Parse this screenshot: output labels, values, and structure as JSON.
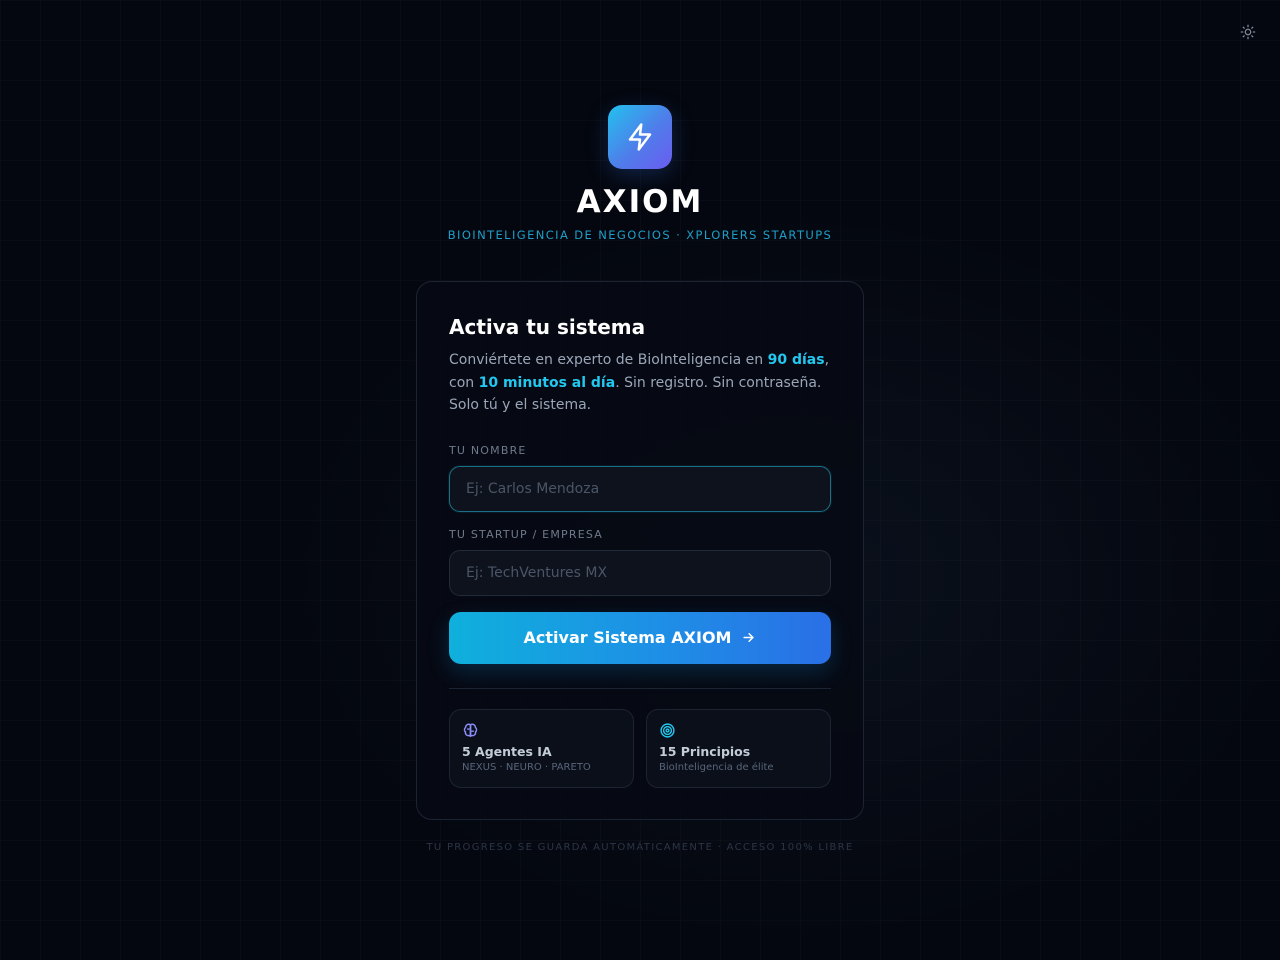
{
  "theme_toggle": {
    "icon": "sun-icon"
  },
  "brand": {
    "logo_icon": "lightning-icon",
    "title": "AXIOM",
    "subtitle": "BIOINTELIGENCIA DE NEGOCIOS · XPLORERS STARTUPS"
  },
  "card": {
    "title": "Activa tu sistema",
    "description": {
      "part1": "Conviértete en experto de BioInteligencia en ",
      "highlight1": "90 días",
      "part2": ", con ",
      "highlight2": "10 minutos al día",
      "part3": ". Sin registro. Sin contraseña. Solo tú y el sistema."
    },
    "name_field": {
      "label": "TU NOMBRE",
      "placeholder": "Ej: Carlos Mendoza",
      "value": ""
    },
    "company_field": {
      "label": "TU STARTUP / EMPRESA",
      "placeholder": "Ej: TechVentures MX",
      "value": ""
    },
    "activate_button": {
      "label": "Activar Sistema AXIOM",
      "icon": "arrow-right-icon"
    },
    "features": [
      {
        "icon": "brain-icon",
        "title": "5 Agentes IA",
        "subtitle": "NEXUS · NEURO · PARETO"
      },
      {
        "icon": "target-icon",
        "title": "15 Principios",
        "subtitle": "BioInteligencia de élite"
      }
    ]
  },
  "footer": {
    "note": "TU PROGRESO SE GUARDA AUTOMÁTICAMENTE · ACCESO 100% LIBRE"
  },
  "colors": {
    "background": "#04070f",
    "accent": "#22c8ef",
    "button_gradient_start": "#0fb0dc",
    "button_gradient_end": "#2a6fe6",
    "logo_gradient_start": "#22c1ee",
    "logo_gradient_end": "#6b5cf0"
  }
}
